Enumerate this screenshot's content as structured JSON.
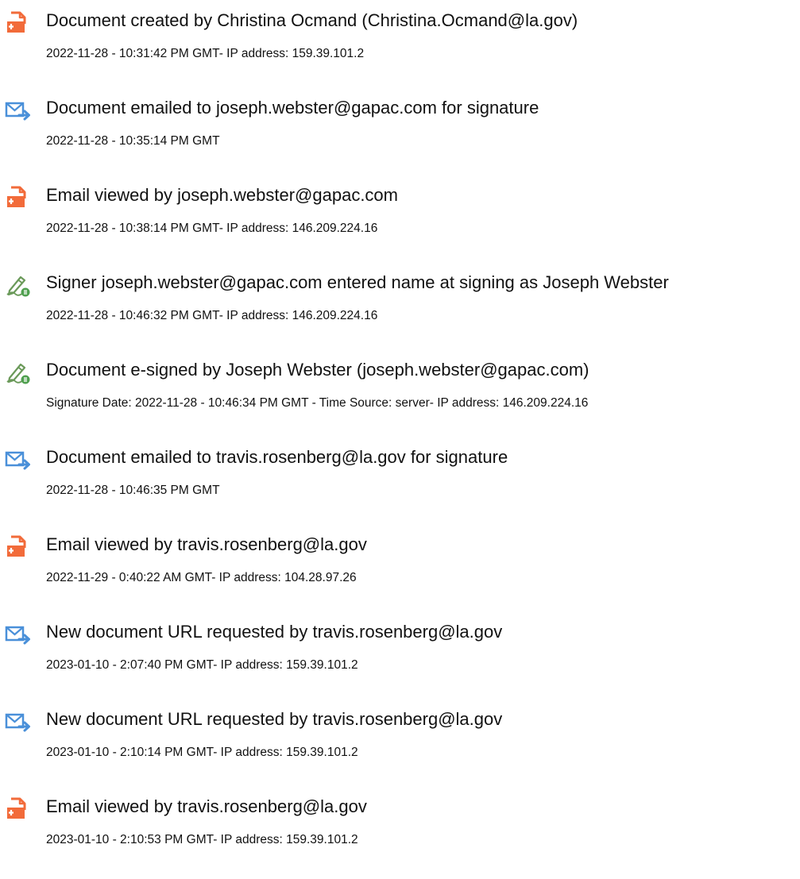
{
  "colors": {
    "document_icon": "#f26b3a",
    "email_icon": "#4a90d9",
    "sign_icon": "#5aa05a",
    "text": "#111111"
  },
  "events": [
    {
      "icon": "document-created-icon",
      "title": "Document created by Christina Ocmand (Christina.Ocmand@la.gov)",
      "detail": "2022-11-28 - 10:31:42 PM GMT- IP address: 159.39.101.2"
    },
    {
      "icon": "email-sent-icon",
      "title": "Document emailed to joseph.webster@gapac.com for signature",
      "detail": "2022-11-28 - 10:35:14 PM GMT"
    },
    {
      "icon": "email-viewed-icon",
      "title": "Email viewed by joseph.webster@gapac.com",
      "detail": "2022-11-28 - 10:38:14 PM GMT- IP address: 146.209.224.16"
    },
    {
      "icon": "signature-icon",
      "title": "Signer joseph.webster@gapac.com entered name at signing as Joseph Webster",
      "detail": "2022-11-28 - 10:46:32 PM GMT- IP address: 146.209.224.16"
    },
    {
      "icon": "signature-icon",
      "title": "Document e-signed by Joseph Webster (joseph.webster@gapac.com)",
      "detail": "Signature Date: 2022-11-28 - 10:46:34 PM GMT - Time Source: server- IP address: 146.209.224.16"
    },
    {
      "icon": "email-sent-icon",
      "title": "Document emailed to travis.rosenberg@la.gov for signature",
      "detail": "2022-11-28 - 10:46:35 PM GMT"
    },
    {
      "icon": "email-viewed-icon",
      "title": "Email viewed by travis.rosenberg@la.gov",
      "detail": "2022-11-29 - 0:40:22 AM GMT- IP address: 104.28.97.26"
    },
    {
      "icon": "email-sent-icon",
      "title": "New document URL requested by travis.rosenberg@la.gov",
      "detail": "2023-01-10 - 2:07:40 PM GMT- IP address: 159.39.101.2"
    },
    {
      "icon": "email-sent-icon",
      "title": "New document URL requested by travis.rosenberg@la.gov",
      "detail": "2023-01-10 - 2:10:14 PM GMT- IP address: 159.39.101.2"
    },
    {
      "icon": "email-viewed-icon",
      "title": "Email viewed by travis.rosenberg@la.gov",
      "detail": "2023-01-10 - 2:10:53 PM GMT- IP address: 159.39.101.2"
    }
  ]
}
